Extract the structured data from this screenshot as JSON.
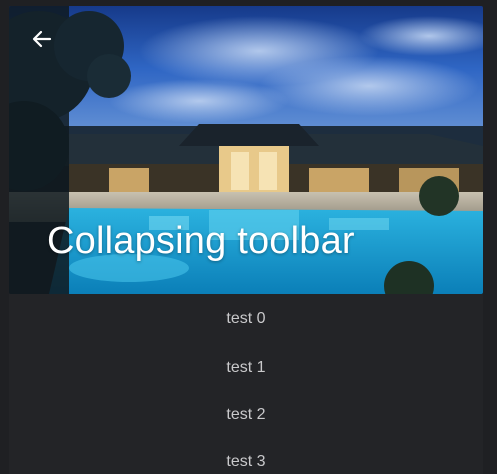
{
  "app_bar": {
    "title": "Collapsing toolbar",
    "back_icon": "arrow-left-icon",
    "title_color": "#ffffff"
  },
  "header_image": {
    "description_icon": "resort-pool-image"
  },
  "list": {
    "items": [
      {
        "label": "test 0"
      },
      {
        "label": "test 1"
      },
      {
        "label": "test 2"
      },
      {
        "label": "test 3"
      }
    ],
    "text_color": "#c9c9cb",
    "background": "#232427"
  }
}
